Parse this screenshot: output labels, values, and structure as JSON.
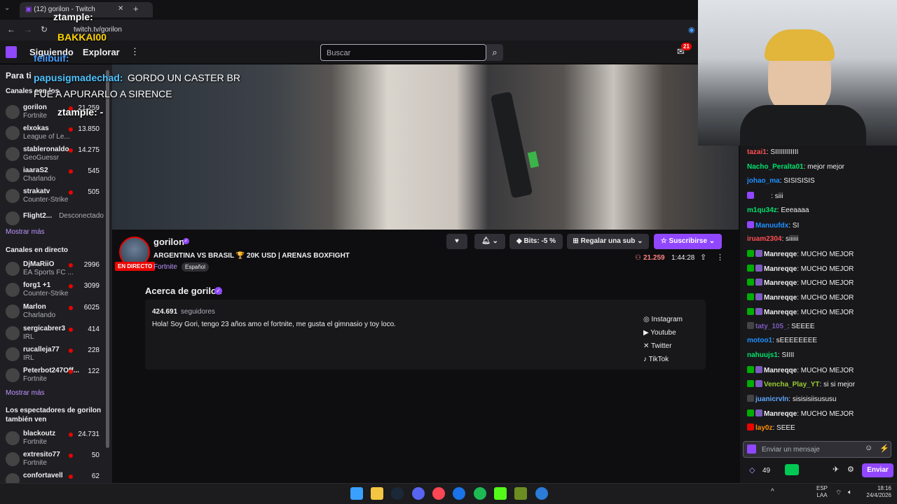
{
  "browser": {
    "tab_title": "(12) gorilon - Twitch",
    "url": "twitch.tv/gorilon"
  },
  "header": {
    "following": "Siguiendo",
    "browse": "Explorar",
    "search_placeholder": "Buscar",
    "notif_count": "21"
  },
  "overlay": {
    "name_top": "ztample:",
    "line1_user": "papusigmadechad:",
    "line1_text": "GORDO UN CASTER BR",
    "line2_text": "FUE A APURARLO A SIRENCE",
    "ztample_mid": "ztample: -",
    "felibuif": "felibuif:",
    "bakk": "BAKKAI00"
  },
  "sidebar": {
    "for_you": "Para ti",
    "recommended_title": "Canales con los",
    "recommended": [
      {
        "name": "gorilon",
        "game": "Fortnite",
        "viewers": "21.259"
      },
      {
        "name": "elxokas",
        "game": "League of Le...",
        "viewers": "13.850"
      },
      {
        "name": "stableronaldo",
        "game": "GeoGuessr",
        "viewers": "14.275"
      },
      {
        "name": "iaaraS2",
        "game": "Charlando",
        "viewers": "545"
      },
      {
        "name": "strakatv",
        "game": "Counter-Strike",
        "viewers": "505"
      },
      {
        "name": "Flight2...",
        "game": "",
        "viewers": "Desconectado"
      }
    ],
    "show_more_1": "Mostrar más",
    "live_title": "Canales en directo",
    "live": [
      {
        "name": "DjMaRiiO",
        "game": "EA Sports FC ...",
        "viewers": "2996"
      },
      {
        "name": "forg1 +1",
        "game": "Counter-Strike",
        "viewers": "3099"
      },
      {
        "name": "Marlon",
        "game": "Charlando",
        "viewers": "6025"
      },
      {
        "name": "sergicabrer3",
        "game": "IRL",
        "viewers": "414"
      },
      {
        "name": "rucalleja77",
        "game": "IRL",
        "viewers": "228"
      },
      {
        "name": "Peterbot247Off...",
        "game": "Fortnite",
        "viewers": "122"
      }
    ],
    "show_more_2": "Mostrar más",
    "viewers_also_title": "Los espectadores de gorilon también ven",
    "also": [
      {
        "name": "blackoutz",
        "game": "Fortnite",
        "viewers": "24.731"
      },
      {
        "name": "extresito77",
        "game": "Fortnite",
        "viewers": "50"
      },
      {
        "name": "confortavell",
        "game": "",
        "viewers": "62"
      }
    ]
  },
  "stream": {
    "channel": "gorilon",
    "title": "ARGENTINA VS BRASIL 🏆 20K USD | ARENAS BOXFIGHT",
    "game": "Fortnite",
    "tag": "Español",
    "live_badge": "EN DIRECTO",
    "viewers": "21.259",
    "uptime": "1:44:28",
    "bits": "Bits: -5 %",
    "gift": "Regalar una sub",
    "subscribe": "Suscribirse"
  },
  "about": {
    "heading": "Acerca de gorilon",
    "followers_count": "424.691",
    "followers_label": "seguidores",
    "bio": "Hola! Soy Gori, tengo 23 años amo el fortnite, me gusta el gimnasio y toy loco.",
    "socials": [
      "Instagram",
      "Youtube",
      "Twitter",
      "TikTok"
    ]
  },
  "chat": {
    "messages": [
      {
        "user": "tazai1",
        "text": "SIIIIIIIIIIII",
        "color": "#ff4f4f",
        "badge": ""
      },
      {
        "user": "Nacho_Peralta01",
        "text": "mejor mejor",
        "color": "#00e36b",
        "badge": ""
      },
      {
        "user": "johao_ma",
        "text": "SISISISIS",
        "color": "#1e90ff",
        "badge": ""
      },
      {
        "user": "        ",
        "text": "siii",
        "color": "#7d5bbe",
        "badge": "sub"
      },
      {
        "user": "m1qu34z",
        "text": "Eeeaaaa",
        "color": "#00e36b",
        "badge": ""
      },
      {
        "user": "Manuufdx",
        "text": "SI",
        "color": "#1e90ff",
        "badge": "sub"
      },
      {
        "user": "iruam2304",
        "text": "siiiiii",
        "color": "#ff4f4f",
        "badge": ""
      },
      {
        "user": "Manreqqe",
        "text": "MUCHO MEJOR",
        "color": "#efeff1",
        "badge": "mod"
      },
      {
        "user": "Manreqqe",
        "text": "MUCHO MEJOR",
        "color": "#efeff1",
        "badge": "mod"
      },
      {
        "user": "Manreqqe",
        "text": "MUCHO MEJOR",
        "color": "#efeff1",
        "badge": "mod"
      },
      {
        "user": "Manreqqe",
        "text": "MUCHO MEJOR",
        "color": "#efeff1",
        "badge": "mod"
      },
      {
        "user": "Manreqqe",
        "text": "MUCHO MEJOR",
        "color": "#efeff1",
        "badge": "mod"
      },
      {
        "user": "taty_105_",
        "text": "SEEEE",
        "color": "#7d5bbe",
        "badge": "other"
      },
      {
        "user": "motoo1",
        "text": "sEEEEEEEE",
        "color": "#1e90ff",
        "badge": ""
      },
      {
        "user": "nahuujs1",
        "text": "SIIII",
        "color": "#00e36b",
        "badge": ""
      },
      {
        "user": "Manreqqe",
        "text": "MUCHO MEJOR",
        "color": "#efeff1",
        "badge": "mod"
      },
      {
        "user": "Vencha_Play_YT",
        "text": "si si mejor",
        "color": "#9acd32",
        "badge": "mod"
      },
      {
        "user": "juanicrvln",
        "text": "sisisisiisususu",
        "color": "#5fa8ff",
        "badge": "other"
      },
      {
        "user": "Manreqqe",
        "text": "MUCHO MEJOR",
        "color": "#efeff1",
        "badge": "mod"
      },
      {
        "user": "lay0z",
        "text": "SEEE",
        "color": "#ff8c00",
        "badge": "x"
      }
    ],
    "input_placeholder": "Enviar un mensaje",
    "points": "49",
    "send": "Enviar"
  },
  "taskbar": {
    "lang1": "ESP",
    "lang2": "LAA",
    "time": "18:16",
    "date": "24/4/2026"
  },
  "colors": {
    "accent": "#9147ff",
    "live": "#eb0400",
    "bg": "#0e0e10"
  }
}
